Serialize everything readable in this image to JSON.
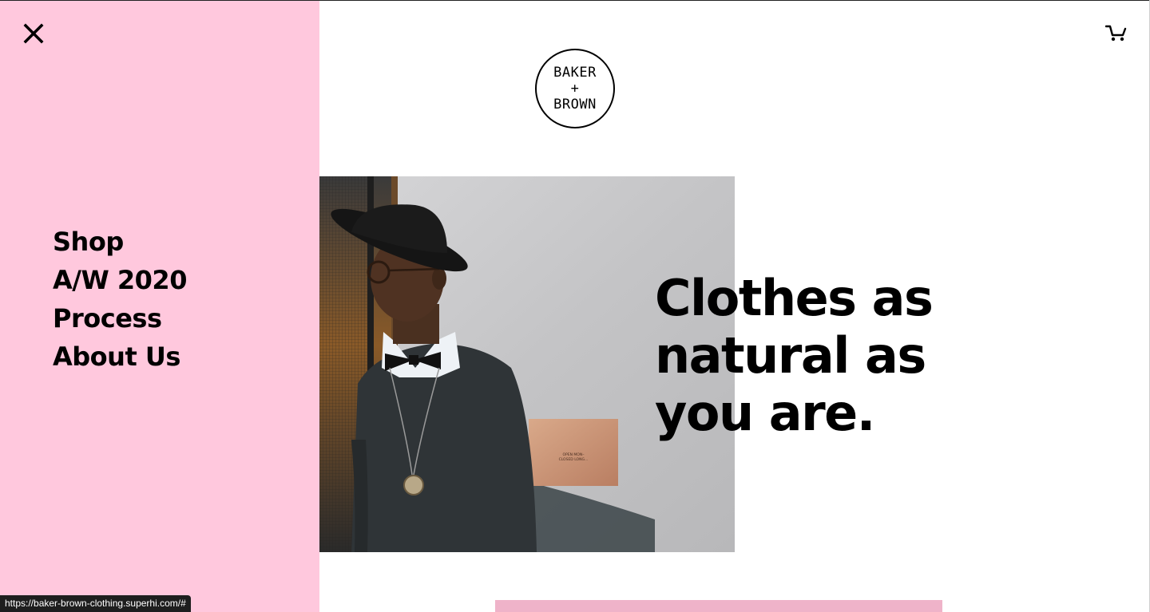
{
  "menu": {
    "close_icon": "close-icon",
    "items": [
      {
        "label": "Shop"
      },
      {
        "label": "A/W 2020"
      },
      {
        "label": "Process"
      },
      {
        "label": "About Us"
      }
    ],
    "background_color": "#ffc8dd"
  },
  "header": {
    "logo_lines": [
      "BAKER",
      "+",
      "BROWN"
    ],
    "cart_icon": "cart-icon"
  },
  "hero": {
    "heading": "Clothes as natural as you are.",
    "image_description_icon": "photo-man-in-hat",
    "plaque_lines": [
      "OPEN MON–",
      "CLOSED LONG…"
    ]
  },
  "status_bar": {
    "url": "https://baker-brown-clothing.superhi.com/#"
  },
  "colors": {
    "menu_pink": "#ffc8dd",
    "next_block_pink": "#efb3c9",
    "text": "#000000"
  }
}
